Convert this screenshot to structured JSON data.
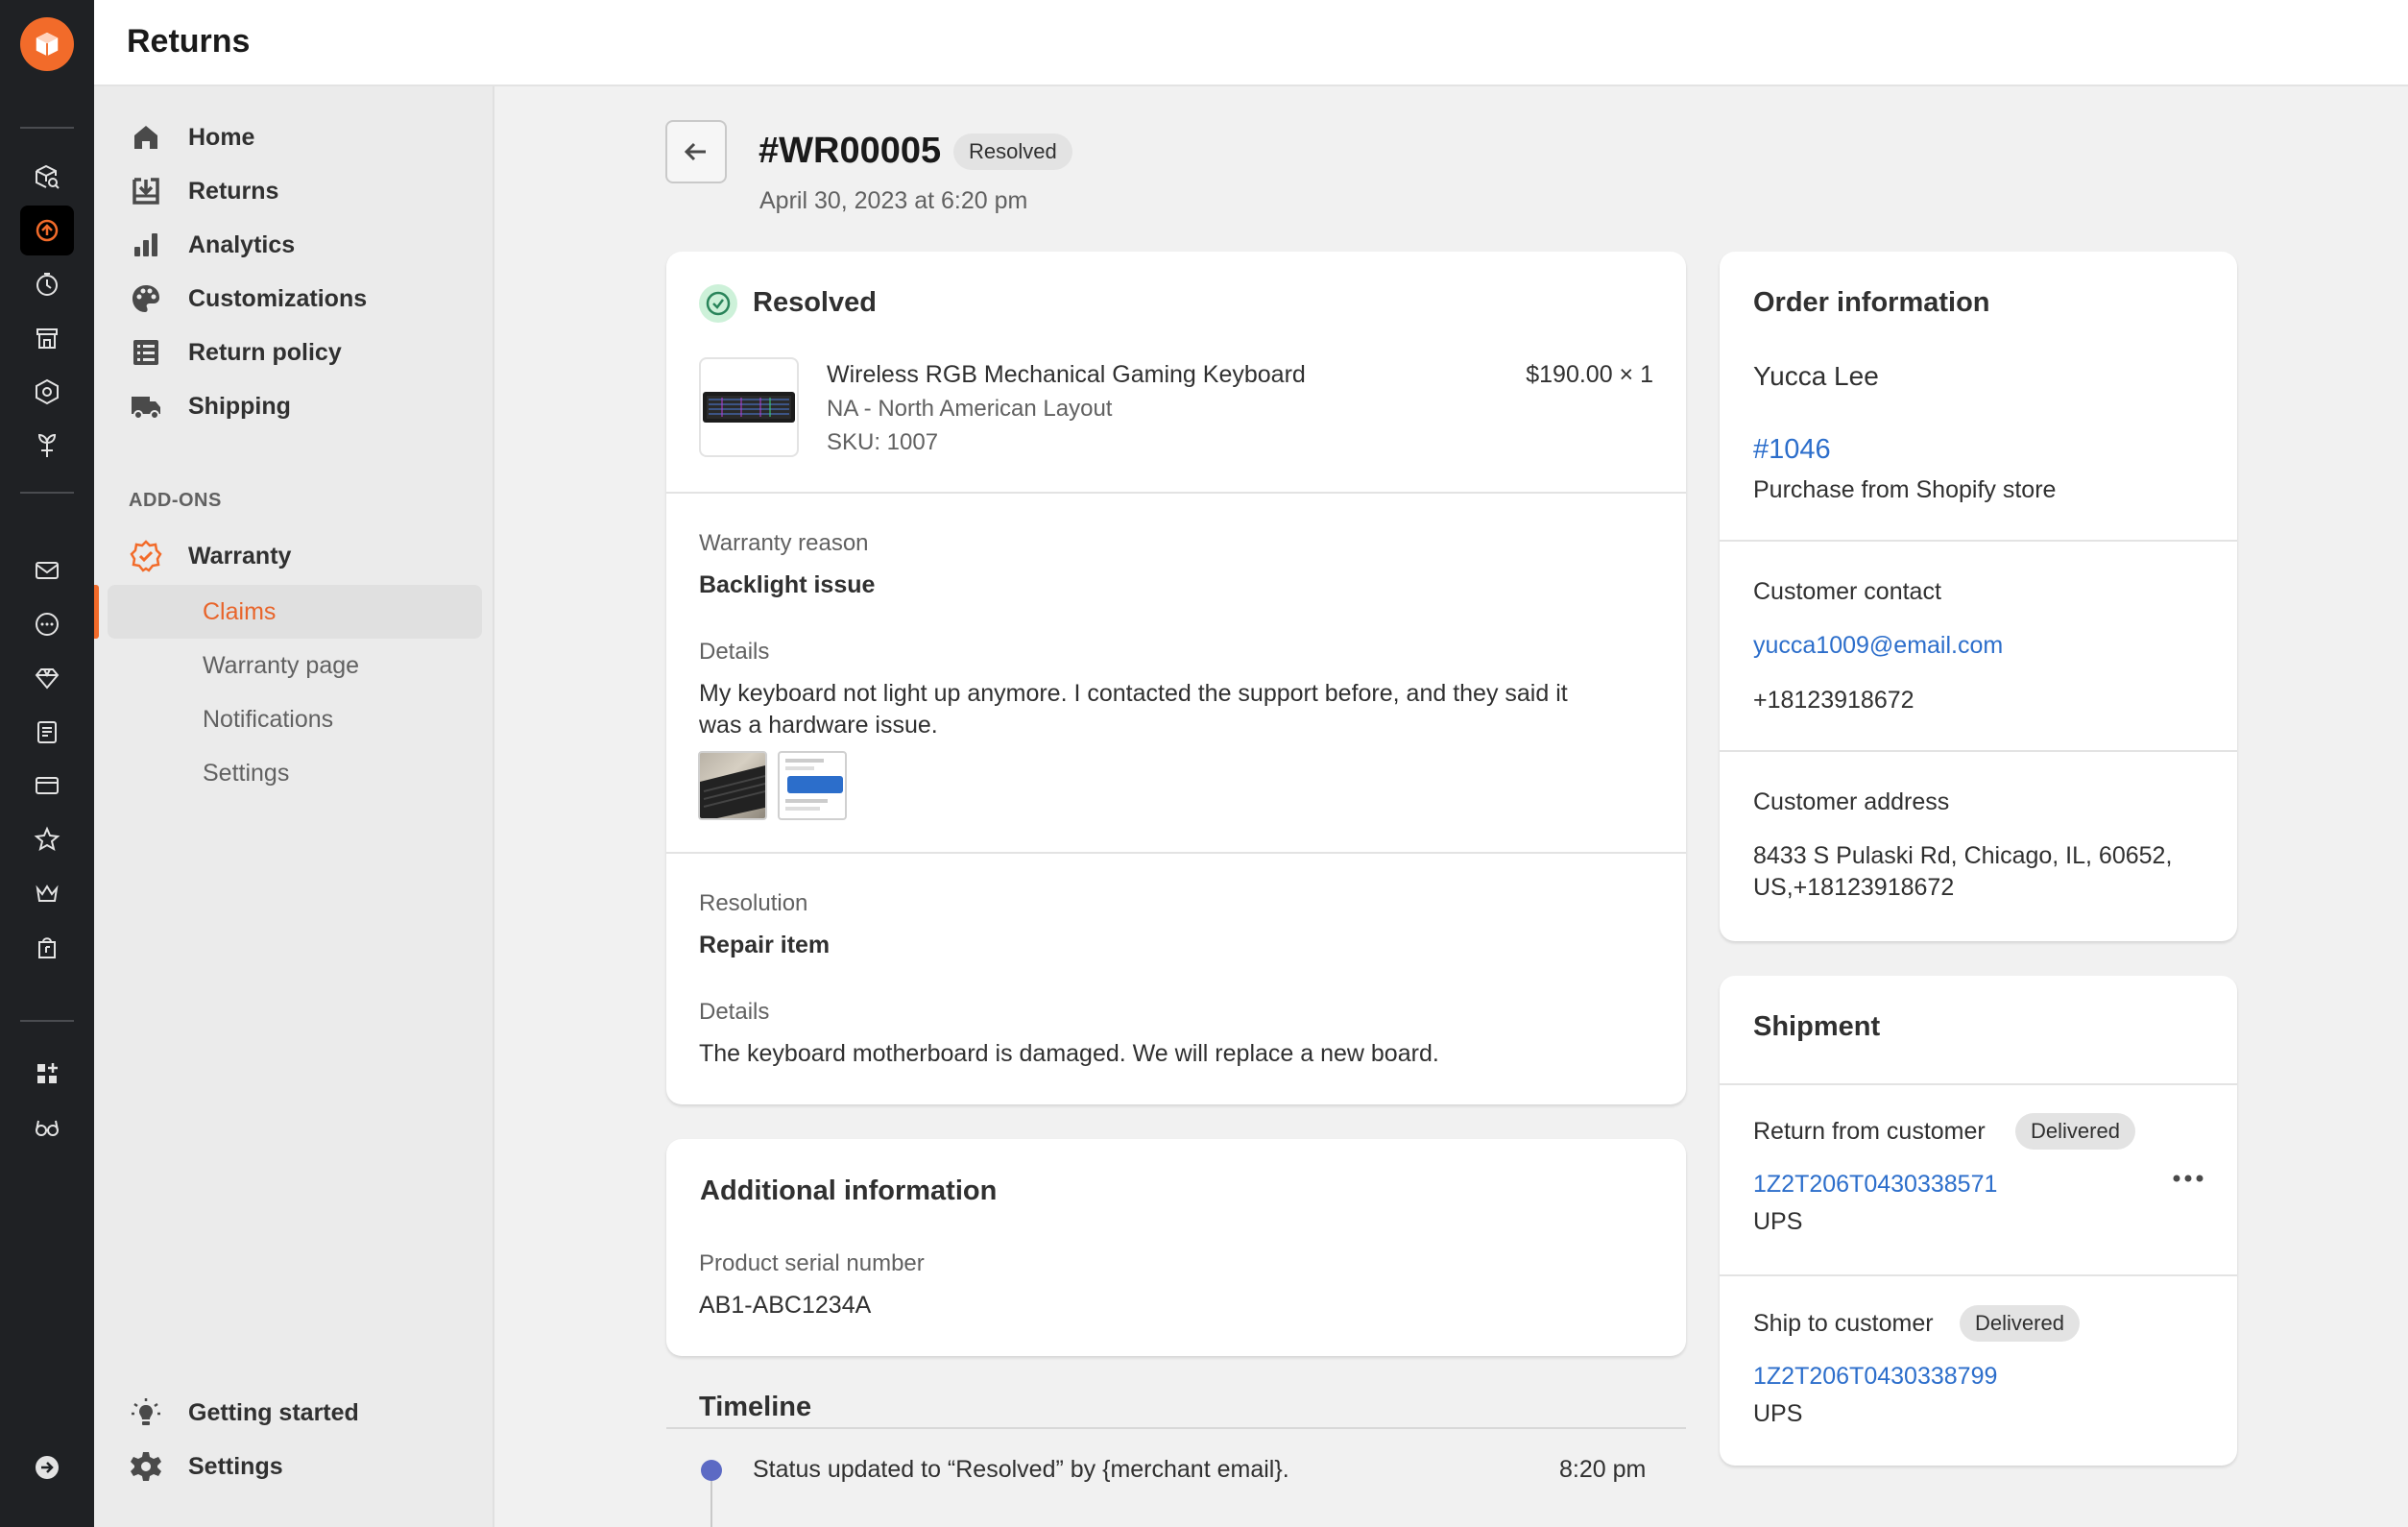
{
  "topbar": {
    "title": "Returns"
  },
  "nav": {
    "items": [
      {
        "label": "Home",
        "icon": "home-icon"
      },
      {
        "label": "Returns",
        "icon": "returns-icon"
      },
      {
        "label": "Analytics",
        "icon": "analytics-icon"
      },
      {
        "label": "Customizations",
        "icon": "palette-icon"
      },
      {
        "label": "Return policy",
        "icon": "list-icon"
      },
      {
        "label": "Shipping",
        "icon": "truck-icon"
      }
    ],
    "section_label": "ADD-ONS",
    "warranty": {
      "label": "Warranty",
      "icon": "warranty-badge-icon"
    },
    "warranty_sub": [
      "Claims",
      "Warranty page",
      "Notifications",
      "Settings"
    ],
    "bottom": [
      {
        "label": "Getting started",
        "icon": "lightbulb-icon"
      },
      {
        "label": "Settings",
        "icon": "gear-icon"
      }
    ]
  },
  "header": {
    "title": "#WR00005",
    "status": "Resolved",
    "date": "April 30, 2023 at 6:20 pm"
  },
  "claim": {
    "status_title": "Resolved",
    "product": {
      "name": "Wireless RGB Mechanical Gaming Keyboard",
      "variant": "NA - North American Layout",
      "sku": "SKU: 1007",
      "price": "$190.00 × 1"
    },
    "warranty_reason_label": "Warranty reason",
    "warranty_reason": "Backlight issue",
    "details_label": "Details",
    "details_line1": "My keyboard not light up anymore. I contacted the support before, and they said it",
    "details_line2": "was a hardware issue.",
    "resolution_label": "Resolution",
    "resolution": "Repair item",
    "resolution_details_label": "Details",
    "resolution_details": "The keyboard motherboard is damaged. We will replace a new board."
  },
  "additional": {
    "title": "Additional information",
    "serial_label": "Product serial number",
    "serial": "AB1-ABC1234A"
  },
  "timeline": {
    "title": "Timeline",
    "events": [
      {
        "text": "Status updated to “Resolved” by {merchant email}.",
        "time": "8:20 pm"
      }
    ]
  },
  "order": {
    "title": "Order information",
    "customer": "Yucca Lee",
    "order_number": "#1046",
    "source": "Purchase from Shopify store",
    "contact_label": "Customer contact",
    "email": "yucca1009@email.com",
    "phone": "+18123918672",
    "address_label": "Customer address",
    "address_line1": "8433 S Pulaski Rd, Chicago, IL, 60652,",
    "address_line2": "US,+18123918672"
  },
  "shipment": {
    "title": "Shipment",
    "return": {
      "label": "Return from customer",
      "status": "Delivered",
      "tracking": "1Z2T206T0430338571",
      "carrier": "UPS"
    },
    "ship": {
      "label": "Ship to customer",
      "status": "Delivered",
      "tracking": "1Z2T206T0430338799",
      "carrier": "UPS"
    }
  },
  "colors": {
    "accent": "#f26b2a",
    "link": "#2c6ecb",
    "success": "#29845a",
    "timeline_dot": "#5c6ac4"
  }
}
